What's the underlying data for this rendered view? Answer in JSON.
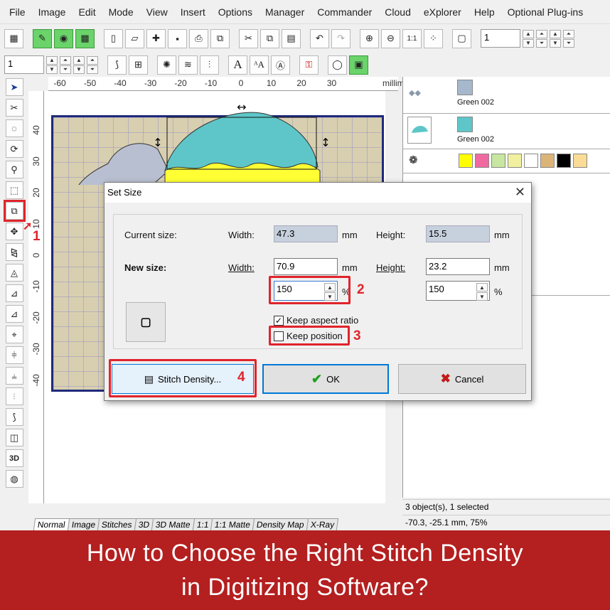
{
  "menu": [
    "File",
    "Image",
    "Edit",
    "Mode",
    "View",
    "Insert",
    "Options",
    "Manager",
    "Commander",
    "Cloud",
    "eXplorer",
    "Help",
    "Optional Plug-ins"
  ],
  "toolbar1": {
    "spin_value": "1"
  },
  "toolbar2": {
    "spin_value": "1"
  },
  "ruler_h": [
    "-60",
    "-50",
    "-40",
    "-30",
    "-20",
    "-10",
    "0",
    "10",
    "20",
    "30"
  ],
  "ruler_unit": "millimeters",
  "ruler_v": [
    "40",
    "30",
    "20",
    "10",
    "0",
    "-10",
    "-20",
    "-30",
    "-40"
  ],
  "view_tabs": [
    "Normal",
    "Image",
    "Stitches",
    "3D",
    "3D Matte",
    "1:1",
    "1:1 Matte",
    "Density Map",
    "X-Ray"
  ],
  "objects": [
    {
      "label": "Green 002",
      "color": "#a6b8cc"
    },
    {
      "label": "Green 002",
      "color": "#5ec6c8"
    }
  ],
  "palette": [
    "#ffff00",
    "#f06aa0",
    "#c8e6a0",
    "#f0f0a0",
    "#ffffff",
    "#dcb478",
    "#000000",
    "#fadc96"
  ],
  "status": {
    "selection": "3 object(s), 1 selected",
    "coords": "-70.3, -25.1 mm, 75%"
  },
  "dialog": {
    "title": "Set Size",
    "current_size_label": "Current size:",
    "new_size_label": "New size:",
    "width_label": "Width:",
    "height_label": "Height:",
    "current_width": "47.3",
    "current_height": "15.5",
    "new_width": "70.9",
    "new_height": "23.2",
    "unit_mm": "mm",
    "width_percent": "150",
    "height_percent": "150",
    "unit_percent": "%",
    "keep_aspect_label": "Keep aspect ratio",
    "keep_aspect_checked": true,
    "keep_position_label": "Keep position",
    "keep_position_checked": false,
    "stitch_density_label": "Stitch Density...",
    "ok_label": "OK",
    "cancel_label": "Cancel"
  },
  "callouts": [
    "1",
    "2",
    "3",
    "4"
  ],
  "banner": {
    "line1": "How to Choose the Right Stitch Density",
    "line2": "in Digitizing Software?"
  }
}
